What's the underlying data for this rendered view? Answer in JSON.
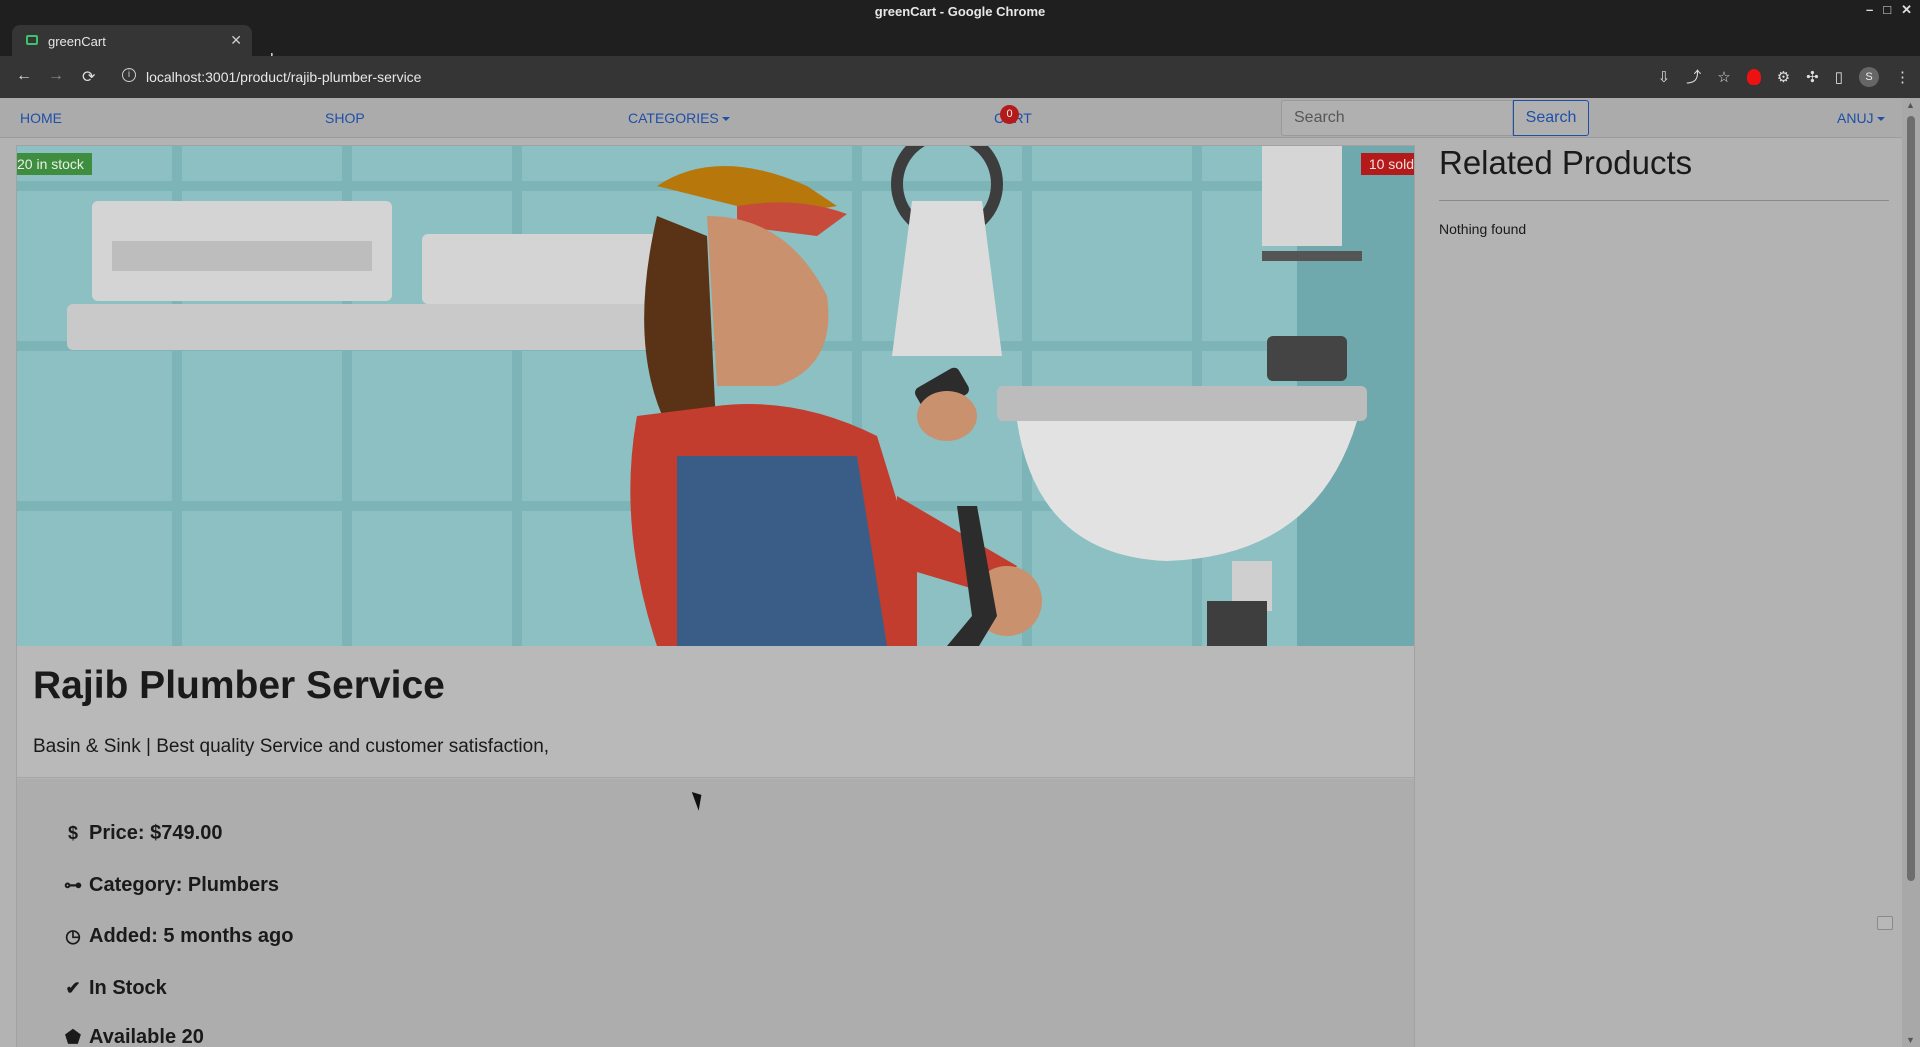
{
  "window": {
    "title": "greenCart - Google Chrome",
    "controls": [
      "–",
      "□",
      "✕"
    ]
  },
  "tab": {
    "title": "greenCart",
    "close": "✕",
    "new_tab": "+",
    "menu": "⌄"
  },
  "toolbar": {
    "back": "←",
    "forward": "→",
    "reload": "⟳",
    "url": "localhost:3001/product/rajib-plumber-service",
    "profile_initial": "S"
  },
  "nav": {
    "home": "HOME",
    "shop": "SHOP",
    "categories": "CATEGORIES",
    "cart": "CART",
    "cart_count": "0",
    "search_placeholder": "Search",
    "search_button": "Search",
    "user": "ANUJ"
  },
  "product": {
    "stock_badge": "20 in stock",
    "sold_badge": "10 sold",
    "title": "Rajib Plumber Service",
    "description": "Basin & Sink | Best quality Service and customer satisfaction,",
    "details": [
      {
        "icon": "dollar-icon",
        "label": "Price: $749.00"
      },
      {
        "icon": "category-icon",
        "label": "Category: Plumbers"
      },
      {
        "icon": "clock-icon",
        "label": "Added: 5 months ago"
      },
      {
        "icon": "check-icon",
        "label": "In Stock"
      },
      {
        "icon": "box-icon",
        "label": "Available 20"
      }
    ]
  },
  "related": {
    "title": "Related Products",
    "empty": "Nothing found"
  }
}
